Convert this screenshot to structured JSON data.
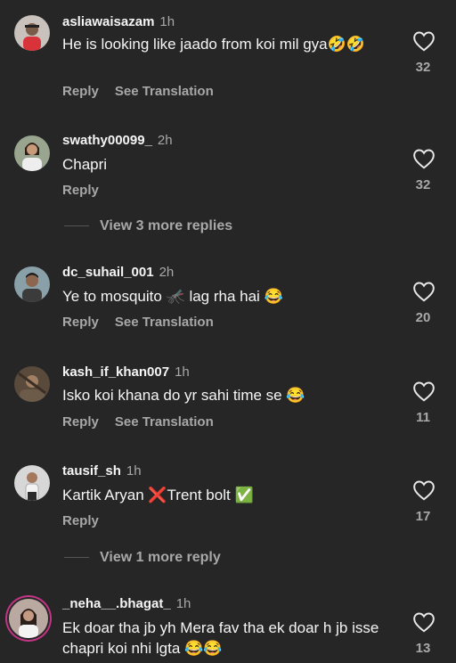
{
  "comments": [
    {
      "user": "asliawaisazam",
      "time": "1h",
      "text": "He is looking like jaado from koi mil gya🤣🤣",
      "reply": "Reply",
      "translate": "See Translation",
      "likes": "32"
    },
    {
      "user": "swathy00099_",
      "time": "2h",
      "text": "Chapri",
      "reply": "Reply",
      "likes": "32",
      "more": "View 3 more replies"
    },
    {
      "user": "dc_suhail_001",
      "time": "2h",
      "text": "Ye to mosquito 🦟 lag rha hai 😂",
      "reply": "Reply",
      "translate": "See Translation",
      "likes": "20"
    },
    {
      "user": "kash_if_khan007",
      "time": "1h",
      "text": "Isko koi khana do yr sahi time se 😂",
      "reply": "Reply",
      "translate": "See Translation",
      "likes": "11"
    },
    {
      "user": "tausif_sh",
      "time": "1h",
      "text": "Kartik Aryan ❌Trent bolt ✅",
      "reply": "Reply",
      "likes": "17",
      "more": "View 1 more reply"
    },
    {
      "user": "_neha__.bhagat_",
      "time": "1h",
      "text": "Ek doar tha jb yh Mera fav tha ek doar h jb isse chapri koi nhi lgta 😂😂",
      "likes": "13"
    }
  ]
}
